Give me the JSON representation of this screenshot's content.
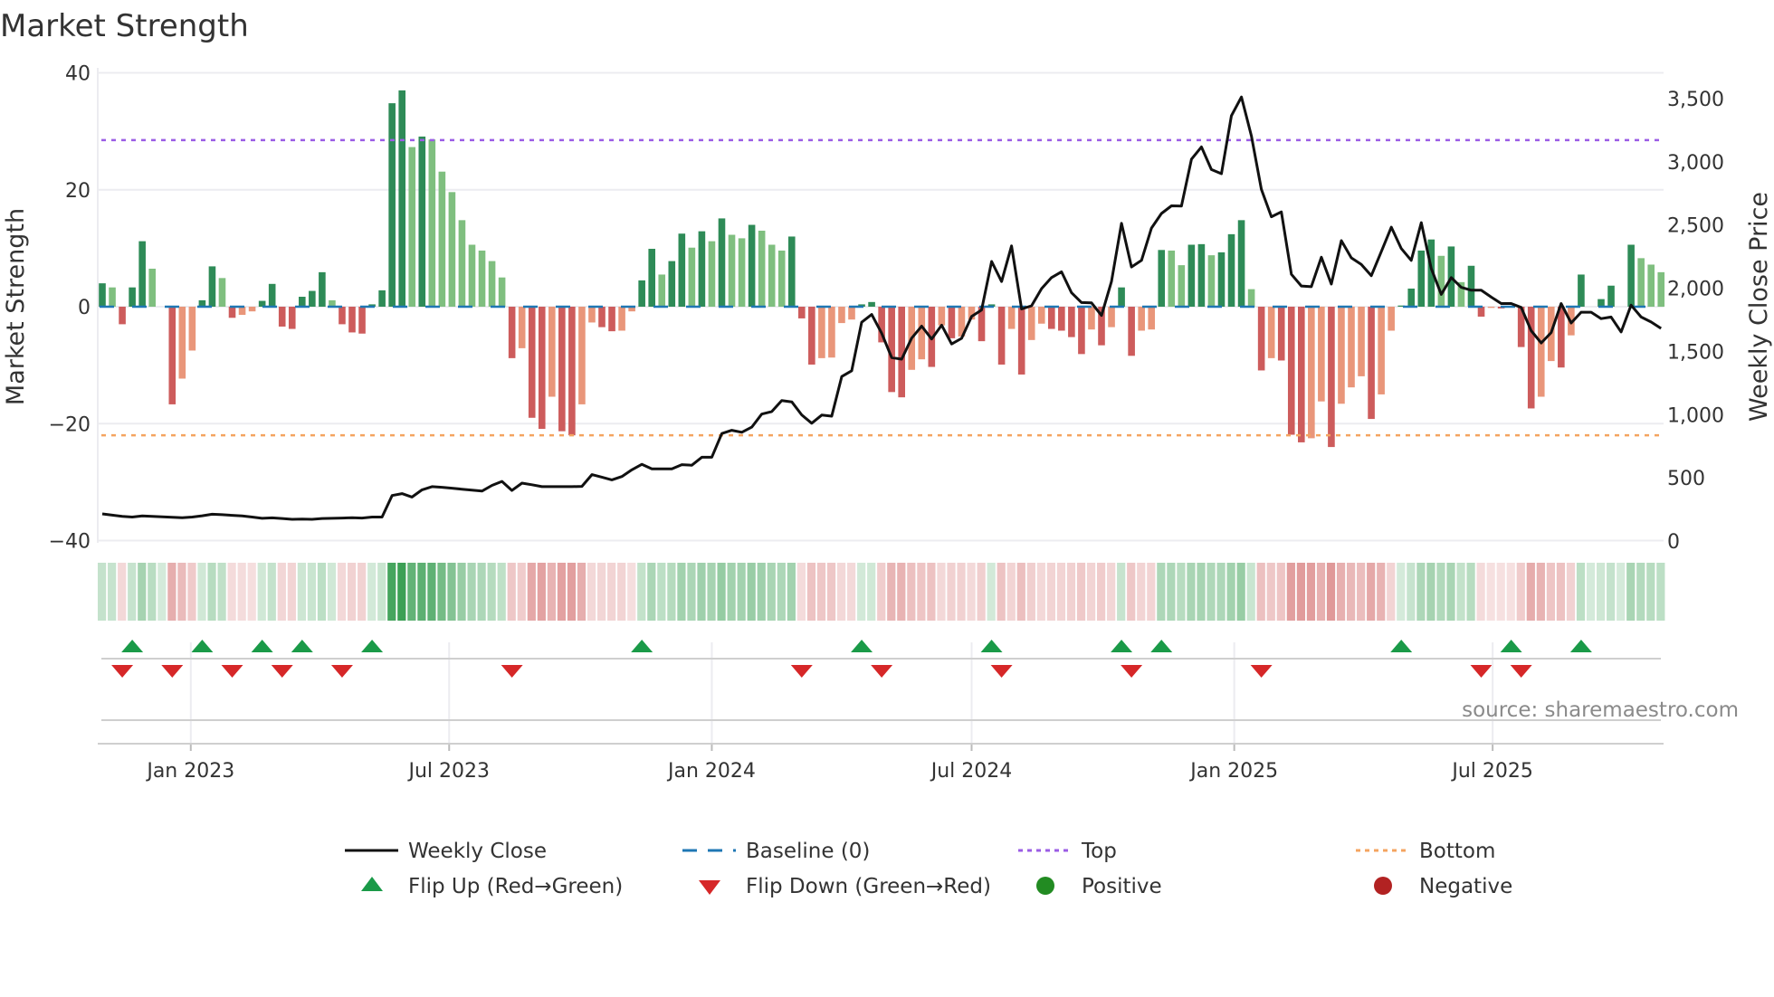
{
  "chart_data": {
    "type": "bar",
    "title": "Market Strength",
    "ylabel": "Market Strength",
    "y2label": "Weekly Close Price",
    "ylim": [
      -40,
      40
    ],
    "y2lim": [
      0,
      3500
    ],
    "yticks": [
      "40",
      "20",
      "0",
      "−20",
      "−40"
    ],
    "ytick_values": [
      40,
      20,
      0,
      -20,
      -40
    ],
    "y2ticks": [
      "0",
      "500",
      "1,000",
      "1,500",
      "2,000",
      "2,500",
      "3,000",
      "3,500"
    ],
    "y2tick_values": [
      0,
      500,
      1000,
      1500,
      2000,
      2500,
      3000,
      3500
    ],
    "first_week": "2022-10-31",
    "xticks": [
      {
        "label": "Jan 2023",
        "date": "2023-01-01"
      },
      {
        "label": "Jul 2023",
        "date": "2023-07-01"
      },
      {
        "label": "Jan 2024",
        "date": "2024-01-01"
      },
      {
        "label": "Jul 2024",
        "date": "2024-07-01"
      },
      {
        "label": "Jan 2025",
        "date": "2025-01-01"
      },
      {
        "label": "Jul 2025",
        "date": "2025-07-01"
      }
    ],
    "top_level": 28.5,
    "bottom_level": -22.0,
    "baseline": 0,
    "strength": [
      4.0,
      3.3,
      -3.0,
      3.3,
      11.2,
      6.5,
      0,
      -16.7,
      -12.3,
      -7.5,
      1.1,
      6.9,
      4.9,
      -1.9,
      -1.4,
      -0.8,
      1.0,
      3.9,
      -3.4,
      -3.8,
      1.7,
      2.7,
      5.9,
      1.1,
      -3.0,
      -4.4,
      -4.6,
      0.4,
      2.8,
      34.8,
      37.0,
      27.3,
      29.1,
      28.6,
      23.1,
      19.6,
      14.8,
      10.6,
      9.6,
      7.8,
      5.0,
      -8.8,
      -7.1,
      -19.0,
      -20.9,
      -15.4,
      -21.3,
      -22.0,
      -16.7,
      -2.7,
      -3.5,
      -4.2,
      -4.1,
      -0.8,
      4.5,
      9.9,
      5.5,
      7.8,
      12.5,
      10.1,
      12.9,
      11.2,
      15.1,
      12.3,
      11.7,
      14.0,
      13.0,
      10.6,
      9.6,
      12.0,
      -2.0,
      -9.9,
      -8.8,
      -8.7,
      -2.8,
      -2.2,
      0.4,
      0.8,
      -6.1,
      -14.6,
      -15.5,
      -10.8,
      -9.0,
      -10.3,
      -3.2,
      -5.4,
      -5.1,
      -2.2,
      -5.9,
      0.4,
      -9.9,
      -3.8,
      -11.6,
      -5.7,
      -2.9,
      -3.8,
      -4.1,
      -5.2,
      -8.1,
      -3.9,
      -6.6,
      -3.5,
      3.3,
      -8.4,
      -4.1,
      -3.9,
      9.7,
      9.6,
      7.1,
      10.6,
      10.7,
      8.8,
      9.3,
      12.4,
      14.8,
      3.0,
      -10.9,
      -8.8,
      -9.2,
      -21.9,
      -23.2,
      -22.5,
      -16.2,
      -24.0,
      -16.6,
      -13.8,
      -11.9,
      -19.2,
      -15.0,
      -4.1,
      0.2,
      3.1,
      9.6,
      11.5,
      8.7,
      10.3,
      4.2,
      7.0,
      -1.7,
      -0.2,
      -0.3,
      0,
      -6.9,
      -17.4,
      -15.4,
      -9.3,
      -10.4,
      -4.9,
      5.5,
      0,
      1.3,
      3.6,
      0,
      10.6,
      8.3,
      7.2,
      5.9
    ],
    "weekly_close": [
      215,
      205,
      195,
      190,
      198,
      195,
      192,
      188,
      185,
      190,
      200,
      212,
      208,
      203,
      198,
      190,
      180,
      183,
      178,
      172,
      174,
      172,
      178,
      180,
      182,
      185,
      182,
      190,
      190,
      360,
      375,
      348,
      405,
      430,
      425,
      418,
      410,
      402,
      395,
      440,
      472,
      400,
      458,
      445,
      430,
      430,
      430,
      430,
      432,
      525,
      505,
      484,
      510,
      563,
      607,
      571,
      571,
      571,
      604,
      600,
      663,
      663,
      850,
      876,
      860,
      901,
      1004,
      1024,
      1111,
      1101,
      998,
      932,
      996,
      988,
      1301,
      1347,
      1731,
      1792,
      1644,
      1451,
      1439,
      1605,
      1700,
      1598,
      1708,
      1559,
      1603,
      1777,
      1828,
      2212,
      2053,
      2335,
      1836,
      1861,
      1997,
      2084,
      2130,
      1964,
      1887,
      1884,
      1784,
      2053,
      2514,
      2168,
      2220,
      2476,
      2591,
      2652,
      2650,
      3021,
      3118,
      2939,
      2906,
      3364,
      3513,
      3205,
      2783,
      2565,
      2604,
      2110,
      2018,
      2012,
      2245,
      2033,
      2376,
      2240,
      2189,
      2099,
      2289,
      2483,
      2314,
      2220,
      2519,
      2156,
      1951,
      2084,
      2007,
      1984,
      1984,
      1930,
      1879,
      1879,
      1848,
      1664,
      1567,
      1649,
      1879,
      1725,
      1810,
      1810,
      1759,
      1772,
      1654,
      1866,
      1772,
      1733,
      1682
    ],
    "flip_up_weeks": [
      3,
      10,
      16,
      20,
      27,
      54,
      76,
      89,
      102,
      106,
      130,
      141,
      148
    ],
    "flip_down_weeks": [
      2,
      7,
      13,
      18,
      24,
      41,
      70,
      78,
      90,
      103,
      116,
      138,
      142
    ],
    "legend": {
      "placement": "bottom",
      "weekly_close": "Weekly Close",
      "baseline": "Baseline (0)",
      "top": "Top",
      "bottom": "Bottom",
      "flip_up": "Flip Up (Red→Green)",
      "flip_down": "Flip Down (Green→Red)",
      "positive": "Positive",
      "negative": "Negative"
    },
    "source": "source: sharemaestro.com",
    "colors": {
      "up_strong": "#2e8b57",
      "up_weak": "#7fbf7f",
      "down_strong": "#cd5c5c",
      "down_weak": "#e9967a",
      "line": "#111111",
      "baseline": "#1f77b4",
      "top": "#9b5de5",
      "bottom": "#f4a460",
      "flip_up": "#1a9a48",
      "flip_down": "#d62728",
      "positive": "#228b22",
      "negative": "#b22222"
    }
  }
}
